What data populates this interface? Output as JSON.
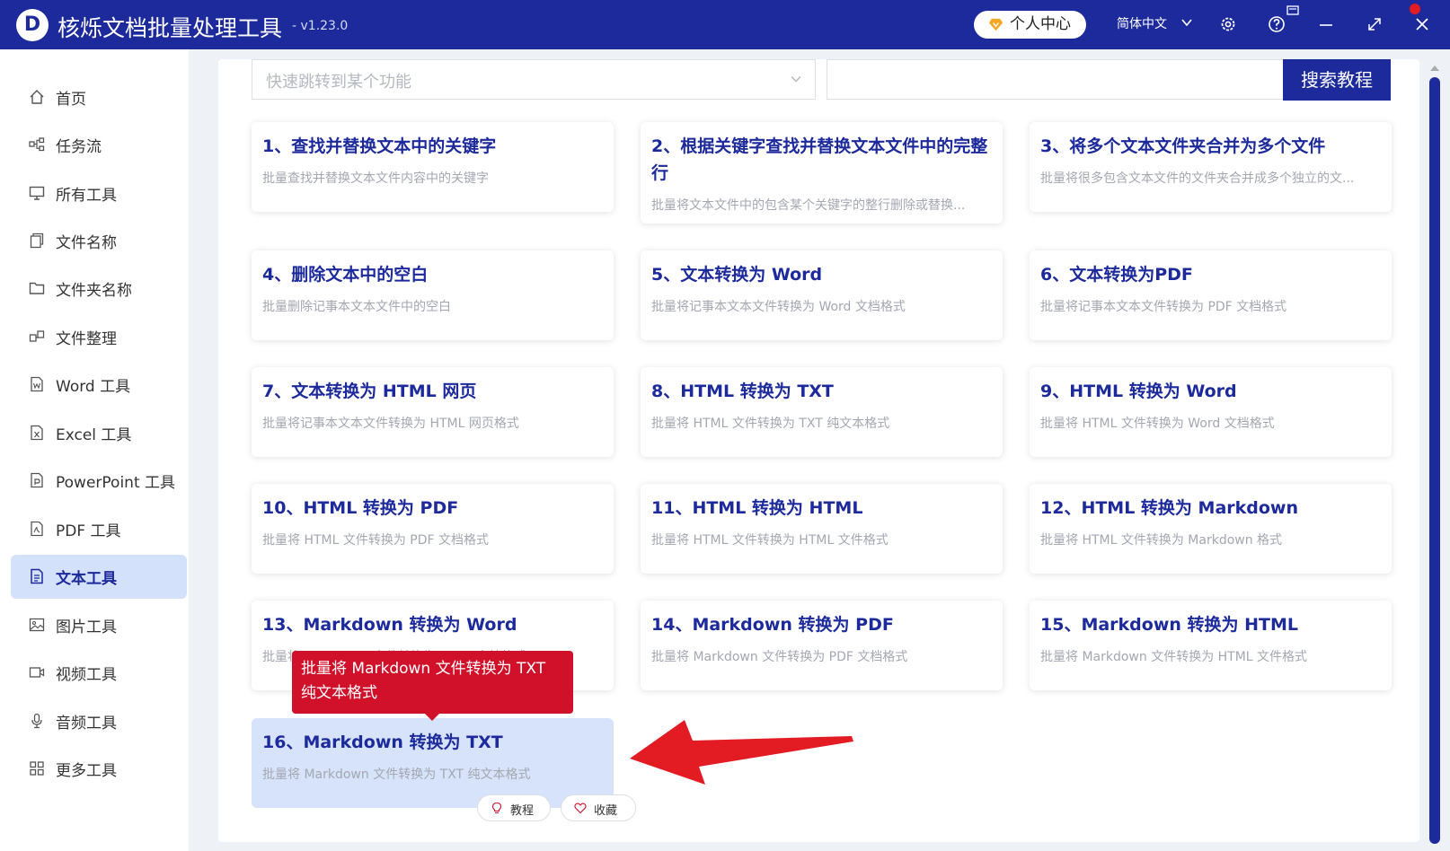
{
  "app": {
    "logo_letter": "D",
    "title": "核烁文档批量处理工具",
    "version": "- v1.23.0",
    "user_center": "个人中心",
    "language": "简体中文"
  },
  "colors": {
    "brand": "#1c2a9c",
    "active_nav": "#d4e1fa",
    "tooltip": "#d1112a",
    "arrow": "#e31b23"
  },
  "sidebar": {
    "items": [
      {
        "label": "首页",
        "icon": "home-icon"
      },
      {
        "label": "任务流",
        "icon": "workflow-icon"
      },
      {
        "label": "所有工具",
        "icon": "monitor-icon"
      },
      {
        "label": "文件名称",
        "icon": "file-copy-icon"
      },
      {
        "label": "文件夹名称",
        "icon": "folder-icon"
      },
      {
        "label": "文件整理",
        "icon": "organize-icon"
      },
      {
        "label": "Word 工具",
        "icon": "word-icon"
      },
      {
        "label": "Excel 工具",
        "icon": "excel-icon"
      },
      {
        "label": "PowerPoint 工具",
        "icon": "ppt-icon"
      },
      {
        "label": "PDF 工具",
        "icon": "pdf-icon"
      },
      {
        "label": "文本工具",
        "icon": "text-file-icon",
        "active": true
      },
      {
        "label": "图片工具",
        "icon": "image-icon"
      },
      {
        "label": "视频工具",
        "icon": "video-icon"
      },
      {
        "label": "音频工具",
        "icon": "mic-icon"
      },
      {
        "label": "更多工具",
        "icon": "grid-icon"
      }
    ]
  },
  "search": {
    "jump_placeholder": "快速跳转到某个功能",
    "search_button": "搜索教程"
  },
  "cards": [
    {
      "title": "1、查找并替换文本中的关键字",
      "desc": "批量查找并替换文本文件内容中的关键字"
    },
    {
      "title": "2、根据关键字查找并替换文本文件中的完整行",
      "desc": "批量将文本文件中的包含某个关键字的整行删除或替换..."
    },
    {
      "title": "3、将多个文本文件夹合并为多个文件",
      "desc": "批量将很多包含文本文件的文件夹合并成多个独立的文..."
    },
    {
      "title": "4、删除文本中的空白",
      "desc": "批量删除记事本文本文件中的空白"
    },
    {
      "title": "5、文本转换为 Word",
      "desc": "批量将记事本文本文件转换为 Word 文档格式"
    },
    {
      "title": "6、文本转换为PDF",
      "desc": "批量将记事本文本文件转换为 PDF 文档格式"
    },
    {
      "title": "7、文本转换为 HTML 网页",
      "desc": "批量将记事本文本文件转换为 HTML 网页格式"
    },
    {
      "title": "8、HTML 转换为 TXT",
      "desc": "批量将 HTML 文件转换为 TXT 纯文本格式"
    },
    {
      "title": "9、HTML 转换为 Word",
      "desc": "批量将 HTML 文件转换为 Word 文档格式"
    },
    {
      "title": "10、HTML 转换为 PDF",
      "desc": "批量将 HTML 文件转换为 PDF 文档格式"
    },
    {
      "title": "11、HTML 转换为 HTML",
      "desc": "批量将 HTML 文件转换为 HTML 文件格式"
    },
    {
      "title": "12、HTML 转换为 Markdown",
      "desc": "批量将 HTML 文件转换为 Markdown 格式"
    },
    {
      "title": "13、Markdown 转换为 Word",
      "desc": "批量将 Markdown 文件转换为 Word 文档格式"
    },
    {
      "title": "14、Markdown 转换为 PDF",
      "desc": "批量将 Markdown 文件转换为 PDF 文档格式"
    },
    {
      "title": "15、Markdown 转换为 HTML",
      "desc": "批量将 Markdown 文件转换为 HTML 文件格式"
    },
    {
      "title": "16、Markdown 转换为 TXT",
      "desc": "批量将 Markdown 文件转换为 TXT 纯文本格式",
      "highlighted": true
    }
  ],
  "tooltip": {
    "text": "批量将 Markdown 文件转换为 TXT 纯文本格式"
  },
  "card_actions": {
    "tutorial": "教程",
    "favorite": "收藏"
  }
}
